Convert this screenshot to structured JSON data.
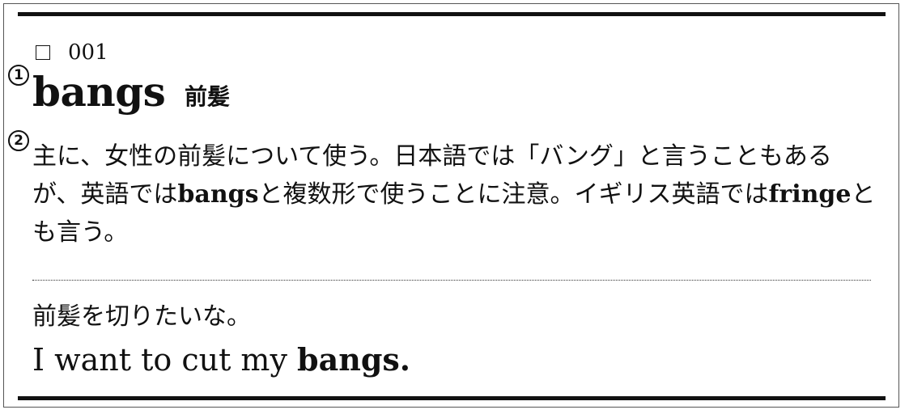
{
  "entry": {
    "checkbox_symbol": "□",
    "number": "001",
    "headword": "bangs",
    "gloss": "前髪",
    "markers": [
      "1",
      "2"
    ]
  },
  "explanation": {
    "text_1": "主に、女性の前髪について使う。日本語では「バング」と言うこともあるが、英語では",
    "bold_1": "bangs",
    "text_2": "と複数形で使うことに注意。イギリス英語では",
    "bold_2": "fringe",
    "text_3": "とも言う。"
  },
  "example": {
    "japanese": "前髪を切りたいな。",
    "english_prefix": "I want to cut my ",
    "english_bold": "bangs."
  }
}
